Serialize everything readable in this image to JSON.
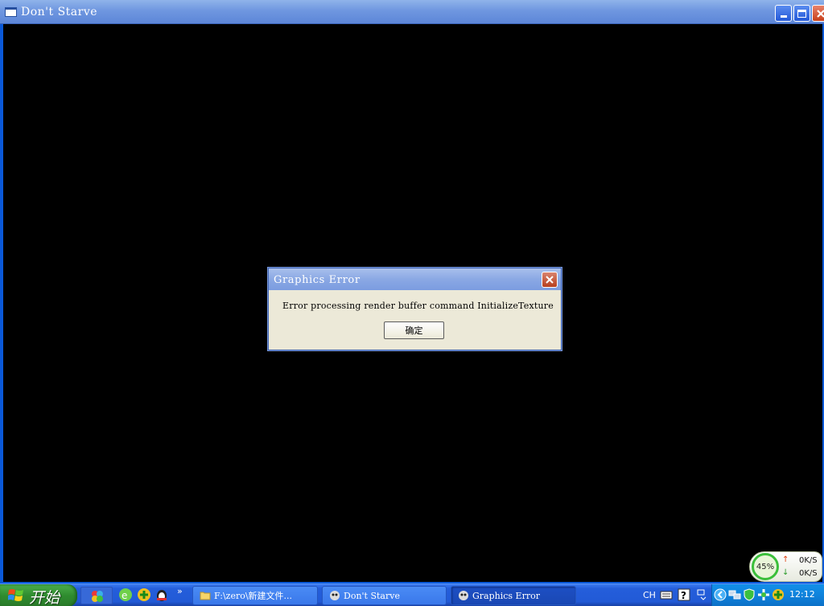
{
  "window": {
    "title": "Don't Starve"
  },
  "dialog": {
    "title": "Graphics Error",
    "message": "Error processing render buffer command InitializeTexture",
    "ok_label": "确定"
  },
  "network": {
    "percent": "45%",
    "upload": "0K/S",
    "download": "0K/S"
  },
  "taskbar": {
    "start_label": "开始",
    "chevron": "»",
    "tasks": [
      {
        "label": "F:\\zero\\新建文件...",
        "icon": "folder-icon"
      },
      {
        "label": "Don't Starve",
        "icon": "dont-starve-icon"
      },
      {
        "label": "Graphics Error",
        "icon": "dont-starve-icon"
      }
    ],
    "language": "CH",
    "clock": "12:12"
  },
  "colors": {
    "taskbar_blue": "#245edb",
    "start_green": "#2f8c2f",
    "dialog_bg": "#ece9d8",
    "title_blue": "#6f97e0"
  }
}
